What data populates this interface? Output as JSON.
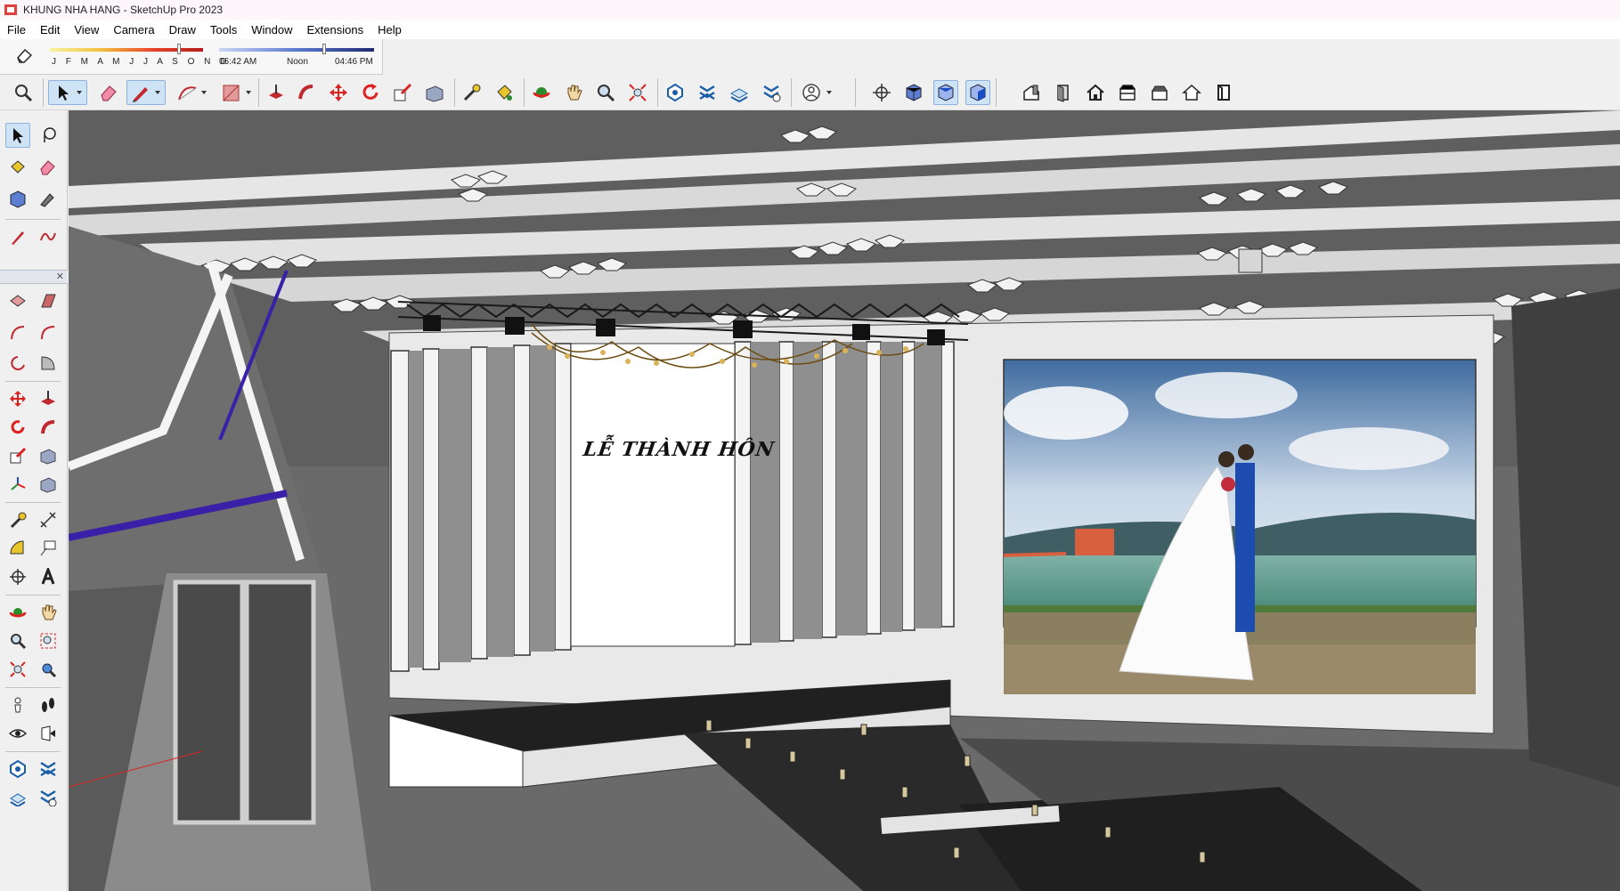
{
  "window": {
    "title": "KHUNG NHA HANG - SketchUp Pro 2023"
  },
  "menu": [
    "File",
    "Edit",
    "View",
    "Camera",
    "Draw",
    "Tools",
    "Window",
    "Extensions",
    "Help"
  ],
  "shadows": {
    "months": "J F M A M J J A S O N D",
    "time_start": "06:42 AM",
    "time_mid": "Noon",
    "time_end": "04:46 PM",
    "month_level": 0.85,
    "time_level": 0.68
  },
  "toolbar_icons": [
    "zoom-icon",
    "select-icon",
    "eraser-icon",
    "pencil-icon",
    "arc-icon",
    "rectangle-icon",
    "push-pull-icon",
    "follow-me-icon",
    "move-icon",
    "rotate-icon",
    "scale-icon",
    "offset-icon",
    "tape-measure-icon",
    "paint-bucket-icon",
    "orbit-icon",
    "pan-icon",
    "zoom-window-icon",
    "zoom-extents-icon",
    "warehouse-icon",
    "extension-warehouse-icon",
    "layout-icon",
    "extension-manager-icon",
    "account-icon",
    "position-camera-icon",
    "iso-view-icon",
    "top-view-icon",
    "front-view-icon",
    "right-view-icon",
    "back-view-icon",
    "left-view-icon",
    "bottom-view-icon",
    "house-icon",
    "section-plane-icon",
    "section-cut-icon"
  ],
  "scene": {
    "stage_sign": "LỄ THÀNH HÔN",
    "colors": {
      "ceiling": "#5d5d5d",
      "floor": "#4a4a4a",
      "wall": "#e8e8e8",
      "accent": "#3a1fa8"
    }
  }
}
